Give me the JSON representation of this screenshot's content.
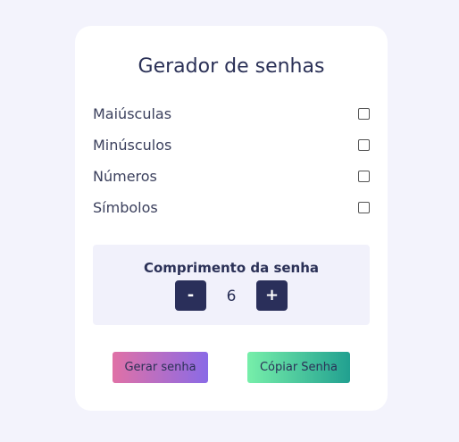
{
  "title": "Gerador de senhas",
  "options": [
    {
      "label": "Maiúsculas",
      "checked": false
    },
    {
      "label": "Minúsculos",
      "checked": false
    },
    {
      "label": "Números",
      "checked": false
    },
    {
      "label": "Símbolos",
      "checked": false
    }
  ],
  "length": {
    "title": "Comprimento da senha",
    "minus_label": "-",
    "value": "6",
    "plus_label": "+"
  },
  "buttons": {
    "generate": "Gerar senha",
    "copy": "Cópiar Senha"
  },
  "colors": {
    "page_bg": "#f3f3fc",
    "card_bg": "#ffffff",
    "accent_dark": "#2a2f5a",
    "generate_gradient": [
      "#e071a6",
      "#8a6ae6"
    ],
    "copy_gradient": [
      "#77efaa",
      "#21a090"
    ]
  }
}
